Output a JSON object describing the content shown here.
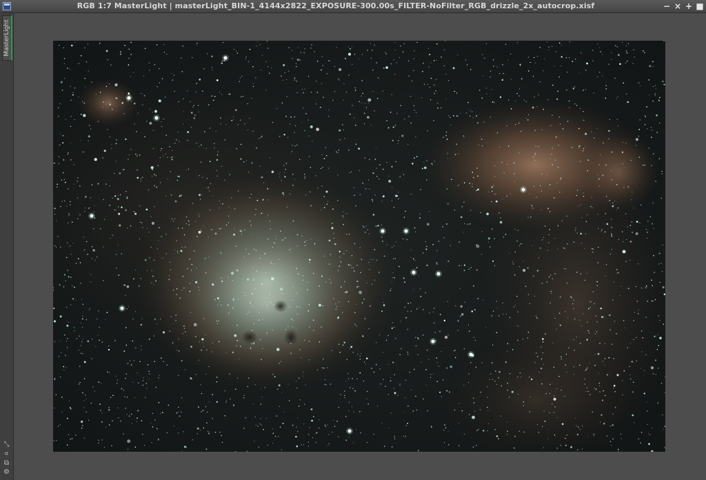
{
  "window": {
    "title": "RGB 1:7 MasterLight | masterLight_BIN-1_4144x2822_EXPOSURE-300.00s_FILTER-NoFilter_RGB_drizzle_2x_autocrop.xisf",
    "buttons": {
      "minimize": "−",
      "shade": "×",
      "maximize": "+",
      "close": "■"
    }
  },
  "sidebar": {
    "tab_label": "MasterLight",
    "icons": [
      "arrows-icon",
      "grid-icon",
      "copy-icon",
      "settings-icon"
    ]
  },
  "image": {
    "icon": "astrophotography-image",
    "colors": {
      "background": "#161a1b",
      "nebula_warm": "#8a6248",
      "nebula_core": "#b9cbbd",
      "stars": "#c9fff2"
    }
  }
}
